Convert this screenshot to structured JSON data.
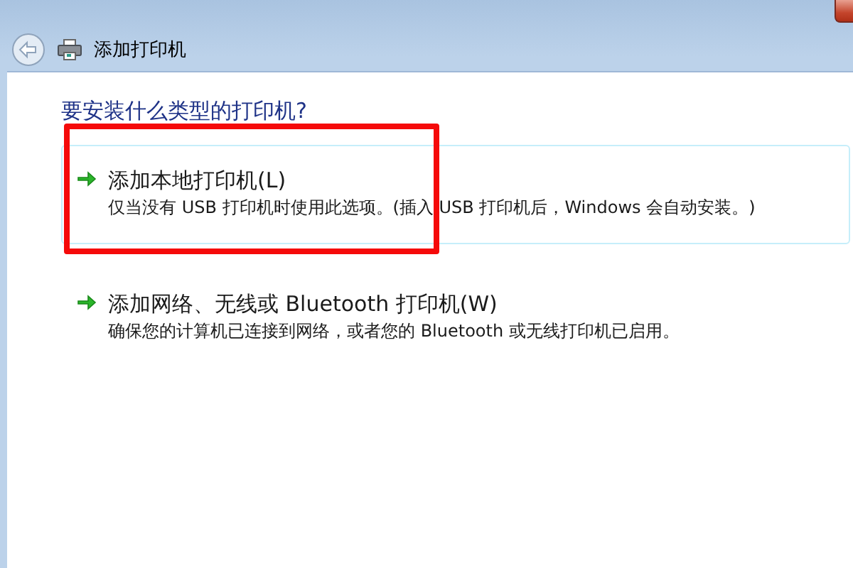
{
  "window": {
    "title": "添加打印机"
  },
  "heading": "要安装什么类型的打印机?",
  "options": [
    {
      "title": "添加本地打印机(L)",
      "description": "仅当没有 USB 打印机时使用此选项。(插入 USB 打印机后，Windows 会自动安装。)",
      "selected": true,
      "highlighted": true
    },
    {
      "title": "添加网络、无线或 Bluetooth 打印机(W)",
      "description": "确保您的计算机已连接到网络，或者您的 Bluetooth 或无线打印机已启用。",
      "selected": false,
      "highlighted": false
    }
  ]
}
